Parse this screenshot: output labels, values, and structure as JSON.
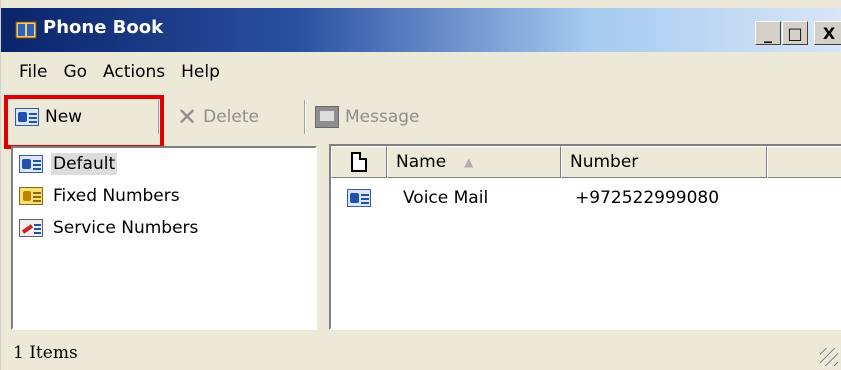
{
  "window": {
    "title": "Phone Book",
    "icon": "phonebook-icon"
  },
  "title_buttons": {
    "minimize": "_",
    "maximize": "□",
    "close": "X"
  },
  "menu": [
    "File",
    "Go",
    "Actions",
    "Help"
  ],
  "toolbar": {
    "new_label": "New",
    "delete_label": "Delete",
    "message_label": "Message",
    "highlight_color": "#e00000"
  },
  "folders": [
    {
      "label": "Default",
      "icon": "contact-card-icon",
      "selected": true
    },
    {
      "label": "Fixed Numbers",
      "icon": "lock-card-icon",
      "selected": false
    },
    {
      "label": "Service Numbers",
      "icon": "service-card-icon",
      "selected": false
    }
  ],
  "columns": {
    "name": "Name",
    "number": "Number"
  },
  "rows": [
    {
      "name": "Voice Mail",
      "number": "+972522999080",
      "icon": "contact-card-icon"
    }
  ],
  "status": {
    "text": "1 Items"
  }
}
